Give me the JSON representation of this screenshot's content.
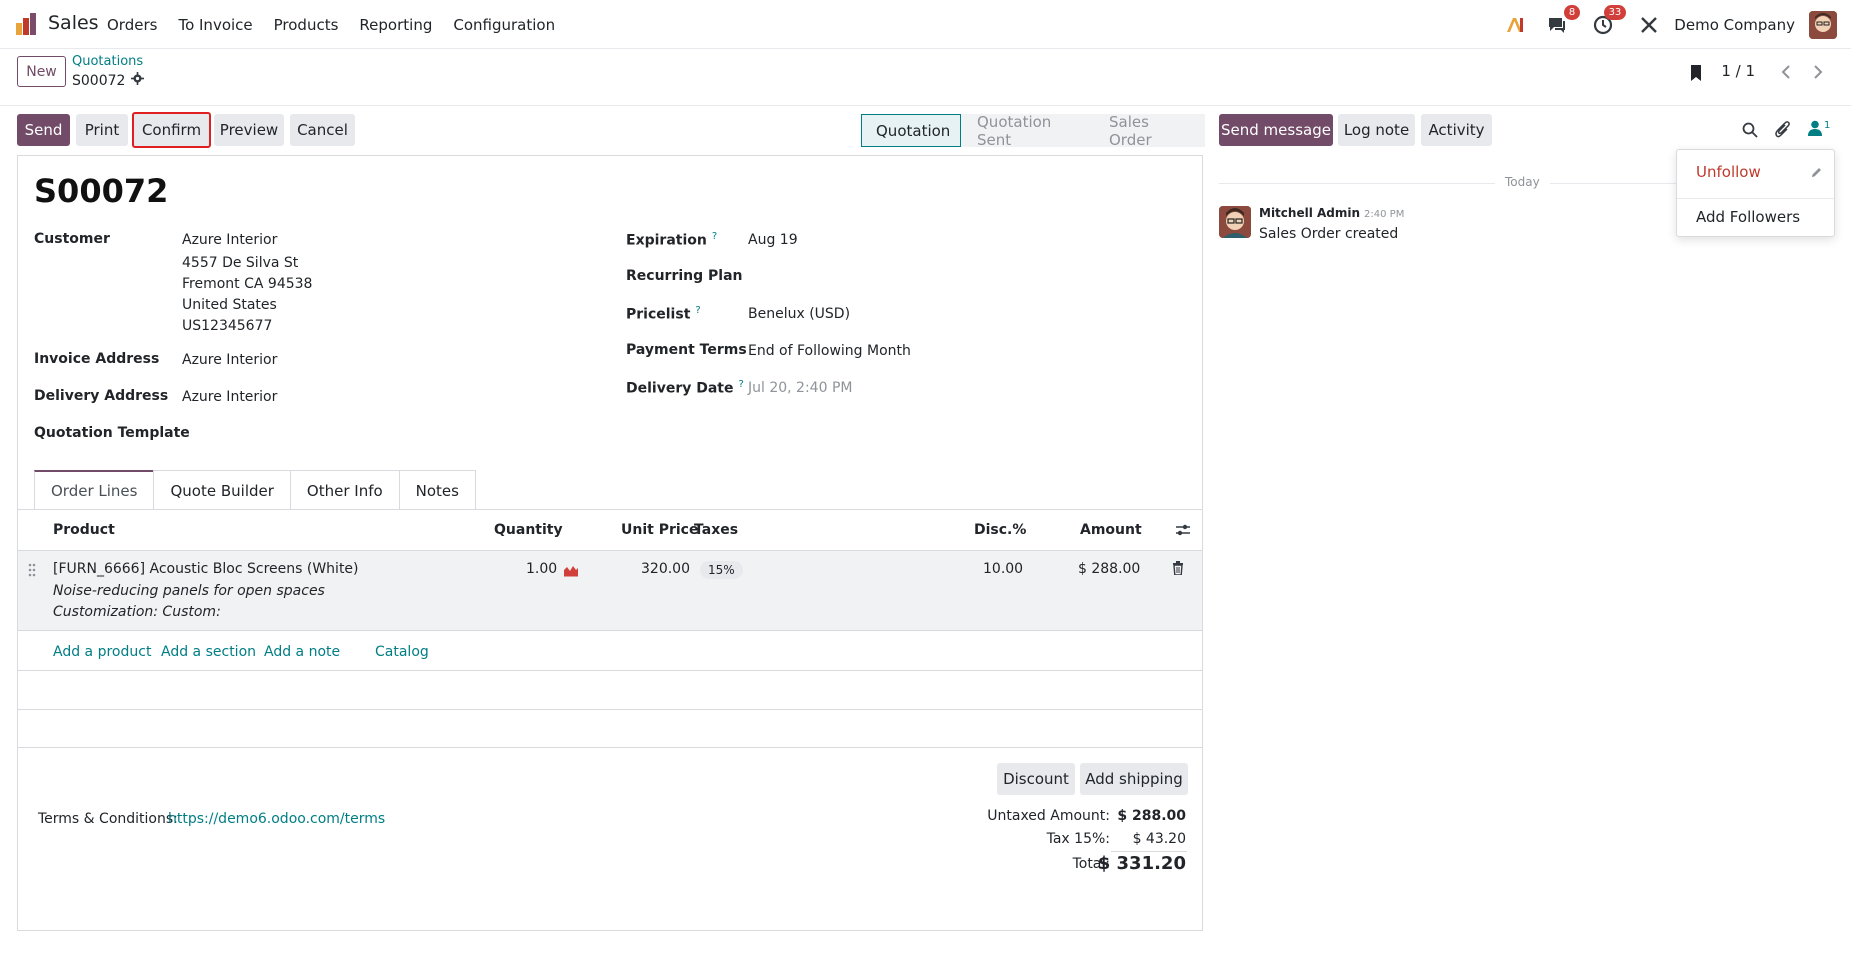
{
  "navbar": {
    "app_name": "Sales",
    "menu": [
      "Orders",
      "To Invoice",
      "Products",
      "Reporting",
      "Configuration"
    ],
    "messages_badge": "8",
    "activities_badge": "33",
    "company": "Demo Company"
  },
  "control_panel": {
    "new_label": "New",
    "breadcrumb_parent": "Quotations",
    "record_name": "S00072",
    "pager": "1 / 1"
  },
  "actions": {
    "send": "Send",
    "print": "Print",
    "confirm": "Confirm",
    "preview": "Preview",
    "cancel": "Cancel"
  },
  "stages": [
    "Quotation",
    "Quotation Sent",
    "Sales Order"
  ],
  "chatter_actions": {
    "send_message": "Send message",
    "log_note": "Log note",
    "activity": "Activity",
    "followers_count": "1"
  },
  "form": {
    "title": "S00072",
    "customer_label": "Customer",
    "customer_name": "Azure Interior",
    "customer_street": "4557 De Silva St",
    "customer_city": "Fremont CA 94538",
    "customer_country": "United States",
    "customer_vat": "US12345677",
    "invoice_label": "Invoice Address",
    "invoice_value": "Azure Interior",
    "delivery_label": "Delivery Address",
    "delivery_value": "Azure Interior",
    "template_label": "Quotation Template",
    "expiration_label": "Expiration",
    "expiration_value": "Aug 19",
    "recurring_label": "Recurring Plan",
    "pricelist_label": "Pricelist",
    "pricelist_value": "Benelux (USD)",
    "payment_terms_label": "Payment Terms",
    "payment_terms_value": "End of Following Month",
    "delivery_date_label": "Delivery Date",
    "delivery_date_value": "Jul 20, 2:40 PM",
    "help_mark": "?"
  },
  "tabs": [
    "Order Lines",
    "Quote Builder",
    "Other Info",
    "Notes"
  ],
  "order_lines": {
    "headers": {
      "product": "Product",
      "quantity": "Quantity",
      "unit_price": "Unit Price",
      "taxes": "Taxes",
      "discount": "Disc.%",
      "amount": "Amount"
    },
    "row": {
      "product": "[FURN_6666] Acoustic Bloc Screens (White)",
      "desc1": "Noise-reducing panels for open spaces",
      "desc2": "Customization: Custom:",
      "quantity": "1.00",
      "unit_price": "320.00",
      "tax": "15%",
      "discount": "10.00",
      "amount": "$ 288.00"
    },
    "add_product": "Add a product",
    "add_section": "Add a section",
    "add_note": "Add a note",
    "catalog": "Catalog"
  },
  "footer": {
    "discount_btn": "Discount",
    "shipping_btn": "Add shipping",
    "terms_label": "Terms & Conditions:",
    "terms_link": "https://demo6.odoo.com/terms",
    "untaxed_label": "Untaxed Amount:",
    "untaxed_value": "$ 288.00",
    "tax_label": "Tax 15%:",
    "tax_value": "$ 43.20",
    "total_label": "Total:",
    "total_value": "$ 331.20"
  },
  "chatter": {
    "date_label": "Today",
    "author": "Mitchell Admin",
    "time": "2:40 PM",
    "body": "Sales Order created"
  },
  "followers_dropdown": {
    "unfollow": "Unfollow",
    "add_followers": "Add Followers"
  },
  "colors": {
    "primary": "#714b67",
    "link": "#017e84",
    "unfollow": "#c0392b",
    "highlight_border": "#e02020"
  }
}
